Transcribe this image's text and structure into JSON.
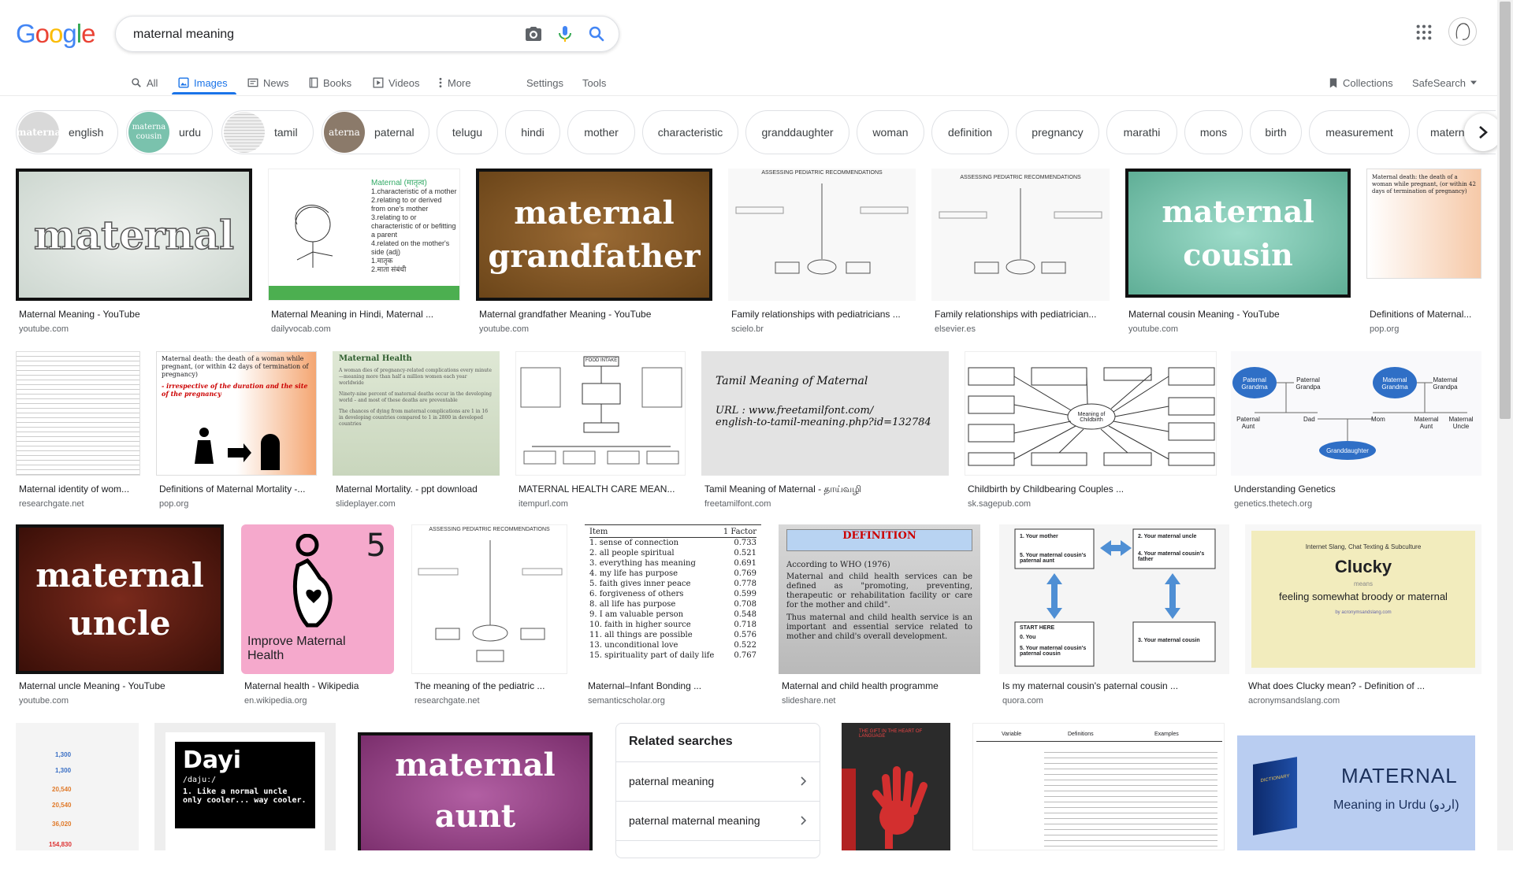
{
  "header": {
    "logo_text": "Google",
    "search_value": "maternal meaning",
    "icons": [
      "camera-icon",
      "mic-icon",
      "search-icon",
      "apps-icon",
      "avatar"
    ]
  },
  "tabs": [
    {
      "label": "All",
      "icon": "search-icon"
    },
    {
      "label": "Images",
      "icon": "image-icon",
      "active": true
    },
    {
      "label": "News",
      "icon": "news-icon"
    },
    {
      "label": "Books",
      "icon": "book-icon"
    },
    {
      "label": "Videos",
      "icon": "play-icon"
    },
    {
      "label": "More",
      "icon": "more-vert-icon"
    }
  ],
  "tools": {
    "settings": "Settings",
    "tools": "Tools",
    "collections": "Collections",
    "safesearch": "SafeSearch"
  },
  "chips": [
    {
      "label": "english",
      "thumb": "materna"
    },
    {
      "label": "urdu",
      "thumb": "materna cousin"
    },
    {
      "label": "tamil",
      "thumb": ""
    },
    {
      "label": "paternal",
      "thumb": "aterna"
    },
    {
      "label": "telugu"
    },
    {
      "label": "hindi"
    },
    {
      "label": "mother"
    },
    {
      "label": "characteristic"
    },
    {
      "label": "granddaughter"
    },
    {
      "label": "woman"
    },
    {
      "label": "definition"
    },
    {
      "label": "pregnancy"
    },
    {
      "label": "marathi"
    },
    {
      "label": "mons"
    },
    {
      "label": "birth"
    },
    {
      "label": "measurement"
    },
    {
      "label": "matern"
    }
  ],
  "results_row1": [
    {
      "caption": "Maternal Meaning - YouTube",
      "source": "youtube.com",
      "img_text": "maternal"
    },
    {
      "caption": "Maternal Meaning in Hindi, Maternal ...",
      "source": "dailyvocab.com",
      "img_text": "Maternal (मातृत्व)",
      "img_lines": [
        "1.characteristic of a mother",
        "2.relating to or derived from one's mother",
        "3.relating to or characteristic of or befitting a parent",
        "4.related on the mother's side (adj)",
        "1.मातृक",
        "2.माता संबंधी"
      ]
    },
    {
      "caption": "Maternal grandfather Meaning - YouTube",
      "source": "youtube.com",
      "img_text": "maternal",
      "img_text2": "grandfather"
    },
    {
      "caption": "Family relationships with pediatricians ...",
      "source": "scielo.br",
      "img_text": "ASSESSING PEDIATRIC RECOMMENDATIONS"
    },
    {
      "caption": "Family relationships with pediatrician...",
      "source": "elsevier.es",
      "img_text": "ASSESSING PEDIATRIC RECOMMENDATIONS"
    },
    {
      "caption": "Maternal cousin Meaning - YouTube",
      "source": "youtube.com",
      "img_text": "maternal",
      "img_text2": "cousin"
    },
    {
      "caption": "Definitions of Maternal...",
      "source": "pop.org",
      "img_text": "Maternal death: the death of a woman while pregnant, (or within 42 days of termination of pregnancy)"
    }
  ],
  "results_row2": [
    {
      "caption": "Maternal identity of wom...",
      "source": "researchgate.net"
    },
    {
      "caption": "Definitions of Maternal Mortality -...",
      "source": "pop.org",
      "img_text": "Maternal death: the death of a woman while pregnant, (or within 42 days of termination of pregnancy)",
      "img_text2": "- irrespective of the duration and the site of the pregnancy"
    },
    {
      "caption": "Maternal Mortality. - ppt download",
      "source": "slideplayer.com",
      "img_title": "Maternal Health",
      "img_lines": [
        "A woman dies of pregnancy-related complications every minute—meaning more than half a million women each year worldwide",
        "Ninety-nine percent of maternal deaths occur in the developing world – and most of these deaths are preventable",
        "The chances of dying from maternal complications are 1 in 16 in developing countries compared to 1 in 2800 in developed countries"
      ]
    },
    {
      "caption": "MATERNAL HEALTH CARE MEAN...",
      "source": "itempurl.com",
      "img_text": "FOOD INTAKE"
    },
    {
      "caption": "Tamil Meaning of Maternal - தாய்வழி",
      "source": "freetamilfont.com",
      "img_title": "Tamil Meaning of Maternal",
      "img_lines": [
        "URL : www.freetamilfont.com/",
        "english-to-tamil-meaning.php?id=132784"
      ]
    },
    {
      "caption": "Childbirth by Childbearing Couples ...",
      "source": "sk.sagepub.com",
      "img_text": "Meaning of Childbirth"
    },
    {
      "caption": "Understanding Genetics",
      "source": "genetics.thetech.org",
      "img_lines": [
        "Paternal Grandma",
        "Paternal Grandpa",
        "Maternal Grandma",
        "Maternal Grandpa",
        "Paternal Aunt",
        "Dad",
        "Mom",
        "Maternal Aunt",
        "Maternal Uncle",
        "Granddaughter"
      ]
    }
  ],
  "results_row3": [
    {
      "caption": "Maternal uncle Meaning - YouTube",
      "source": "youtube.com",
      "img_text": "maternal",
      "img_text2": "uncle"
    },
    {
      "caption": "Maternal health - Wikipedia",
      "source": "en.wikipedia.org",
      "img_text": "Improve Maternal Health",
      "img_num": "5"
    },
    {
      "caption": "The meaning of the pediatric ...",
      "source": "researchgate.net",
      "img_text": "ASSESSING PEDIATRIC RECOMMENDATIONS"
    },
    {
      "caption": "Maternal–Infant Bonding ...",
      "source": "semanticscholar.org",
      "table_header": [
        "Item",
        "1 Factor"
      ],
      "table_rows": [
        [
          "1. sense of connection",
          "0.733"
        ],
        [
          "2. all people spiritual",
          "0.521"
        ],
        [
          "3. everything has meaning",
          "0.691"
        ],
        [
          "4. my life has purpose",
          "0.769"
        ],
        [
          "5. faith gives inner peace",
          "0.778"
        ],
        [
          "6. forgiveness of others",
          "0.599"
        ],
        [
          "8. all life has purpose",
          "0.708"
        ],
        [
          "9. I am valuable person",
          "0.548"
        ],
        [
          "10. faith in higher source",
          "0.718"
        ],
        [
          "11. all things are possible",
          "0.576"
        ],
        [
          "13. unconditional love",
          "0.522"
        ],
        [
          "15. spirituality part of daily life",
          "0.767"
        ]
      ]
    },
    {
      "caption": "Maternal and child health programme",
      "source": "slideshare.net",
      "img_title": "DEFINITION",
      "img_lines": [
        "According to WHO (1976)",
        "Maternal and child health services can be defined as \"promoting, preventing, therapeutic or rehabilitation facility or care for the mother and child\".",
        "Thus maternal and child health service is an important and essential service related to mother and child's overall development."
      ]
    },
    {
      "caption": "Is my maternal cousin's paternal cousin ...",
      "source": "quora.com",
      "img_lines": [
        "1. Your mother",
        "2. Your maternal uncle",
        "5. Your maternal cousin's paternal aunt",
        "4. Your maternal cousin's father",
        "START HERE",
        "0. You",
        "5. Your maternal cousin's paternal cousin",
        "3. Your maternal cousin"
      ]
    },
    {
      "caption": "What does Clucky mean? - Definition of ...",
      "source": "acronymsandslang.com",
      "img_small": "Internet Slang, Chat Texting & Subculture",
      "img_title": "Clucky",
      "img_means": "means",
      "img_text": "feeling somewhat broody or maternal",
      "img_by": "by acronymsandslang.com"
    }
  ],
  "results_row4": [
    {
      "img_lines": [
        "1,300",
        "1,300",
        "20,540",
        "20,540",
        "36,020",
        "154,830"
      ]
    },
    {
      "img_title": "Dayi",
      "img_sub": "/dajuː/",
      "img_text": "1. Like a normal uncle only cooler... way cooler."
    },
    {
      "img_text": "maternal",
      "img_text2": "aunt"
    },
    {
      "img_small": "THE GIFT IN THE HEART OF LANGUAGE"
    },
    {
      "img_lines": [
        "Variable",
        "Definitions",
        "Examples"
      ]
    },
    {
      "img_title": "MATERNAL",
      "img_text": "Meaning in Urdu (اردو)",
      "img_book": "DICTIONARY"
    }
  ],
  "related": {
    "title": "Related searches",
    "items": [
      "paternal meaning",
      "paternal maternal meaning"
    ]
  },
  "colors": {
    "accent": "#1a73e8",
    "chip_border": "#dfe1e5",
    "muted": "#5f6368"
  }
}
